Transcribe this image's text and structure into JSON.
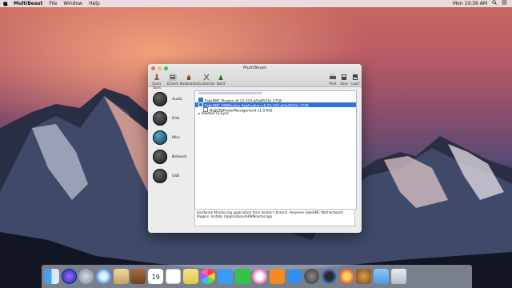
{
  "menubar": {
    "app_name": "MultiBeast",
    "items": [
      "File",
      "Window",
      "Help"
    ],
    "clock": "Mon 10:36 AM"
  },
  "window": {
    "title": "MultiBeast",
    "toolbar_left": [
      "Quick Start",
      "Drivers",
      "Bootloaders",
      "Customize",
      "Build"
    ],
    "toolbar_right": [
      "Print",
      "Save",
      "Load"
    ],
    "selected_tab": "Drivers",
    "categories": [
      "Audio",
      "Disk",
      "Misc",
      "Network",
      "USB"
    ],
    "list_rows": [
      {
        "label": "FakeSMC Plugins v6.25-333-gf3a8520c.1758",
        "checked": true,
        "selected": false
      },
      {
        "label": "FakeSMC HWMonitor Application v6.25-333-gf3a8520c.1758",
        "checked": true,
        "selected": true
      },
      {
        "label": "NullCPUPowerManagement v1.0.0d2",
        "checked": false,
        "selected": false
      },
      {
        "label": "VoodooTSCSync",
        "checked": false,
        "selected": false,
        "expander": true
      }
    ],
    "description": "Hardware Monitoring application from kozlek's branch. Requires FakeSMC Motherboard Plugins. Installs /Applications/HWMonitor.app.",
    "colors": {
      "accent": "#2f74d0",
      "window_bg": "#ececec"
    }
  },
  "dock": {
    "icons": [
      "finder-icon",
      "siri-icon",
      "launchpad-icon",
      "safari-icon",
      "mail-icon",
      "notes-icon",
      "calendar-icon",
      "reminders-icon",
      "stickies-icon",
      "photos-icon",
      "messages-icon",
      "facetime-icon",
      "itunes-icon",
      "ibooks-icon",
      "app-store-icon",
      "system-preferences-icon",
      "quicktime-icon",
      "utility-icon",
      "multibeast-icon",
      "folder-icon",
      "trash-icon"
    ],
    "calendar_day": "19"
  }
}
